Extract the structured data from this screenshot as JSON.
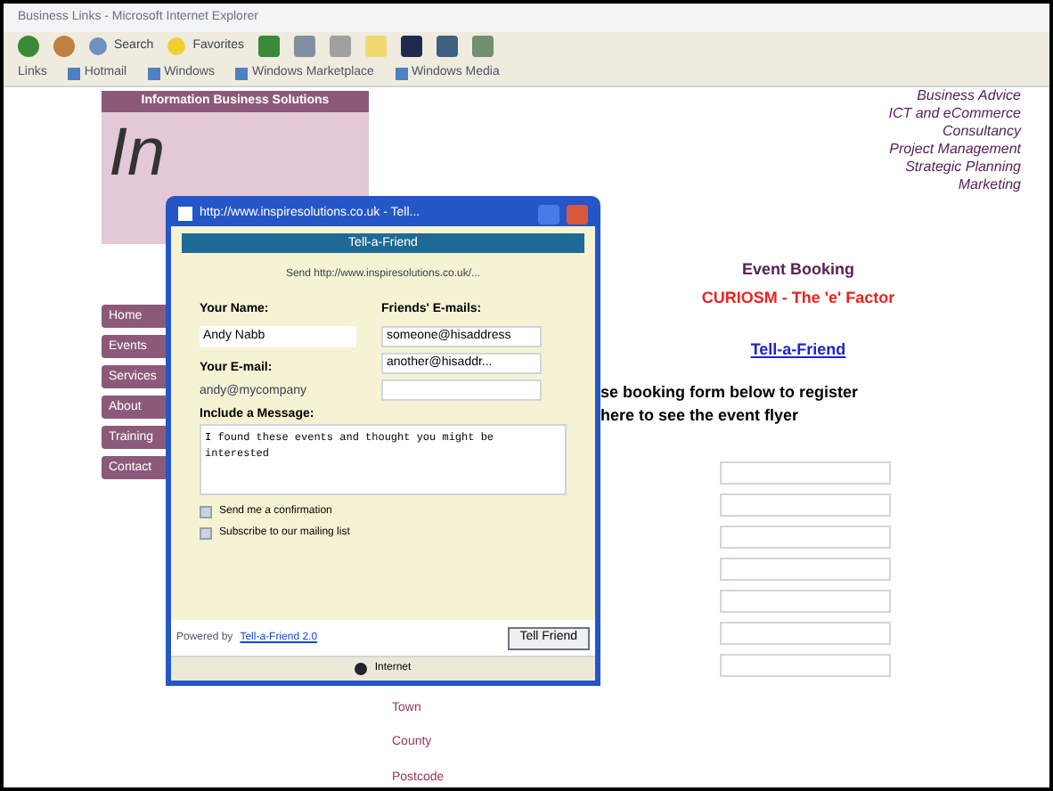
{
  "window": {
    "title": "Business Links - Microsoft Internet Explorer"
  },
  "toolbar": {
    "buttons": [
      {
        "label": "Search"
      },
      {
        "label": "Favorites"
      }
    ]
  },
  "links_bar": {
    "label": "Links",
    "items": [
      "Hotmail",
      "Windows",
      "Windows Marketplace",
      "Windows Media"
    ]
  },
  "page": {
    "logo": {
      "banner": "Information Business Solutions",
      "text": "In"
    },
    "services": [
      "Business Advice",
      "ICT and eCommerce",
      "Consultancy",
      "Project Management",
      "Strategic Planning",
      "Marketing"
    ],
    "menu": [
      "Home",
      "Events",
      "Services",
      "About",
      "Training",
      "Contact"
    ],
    "event_heading": "Event Booking",
    "event_title": "CURIOSM - The 'e' Factor",
    "tell_link": "Tell-a-Friend",
    "lines": [
      "se booking form below to register",
      "here to see the event flyer"
    ],
    "form_labels": [
      "Town",
      "County",
      "Postcode"
    ]
  },
  "popup": {
    "title": "http://www.inspiresolutions.co.uk - Tell...",
    "header": "Tell-a-Friend",
    "intro": "Send http://www.inspiresolutions.co.uk/...",
    "name_label": "Your Name:",
    "name_value": "Andy Nabb",
    "friends_label": "Friends' E-mails:",
    "friend_emails": [
      "someone@hisaddress",
      "another@hisaddr..."
    ],
    "email_label": "Your E-mail:",
    "email_value": "andy@mycompany",
    "message_label": "Include a Message:",
    "message": "I found these events and thought you might be interested",
    "options": [
      {
        "label": "Send me a confirmation",
        "checked": false
      },
      {
        "label": "Subscribe to our mailing list",
        "checked": false
      }
    ],
    "powered": "Powered by",
    "powered_link": "Tell-a-Friend 2.0",
    "button": "Tell Friend",
    "status": "Internet"
  }
}
